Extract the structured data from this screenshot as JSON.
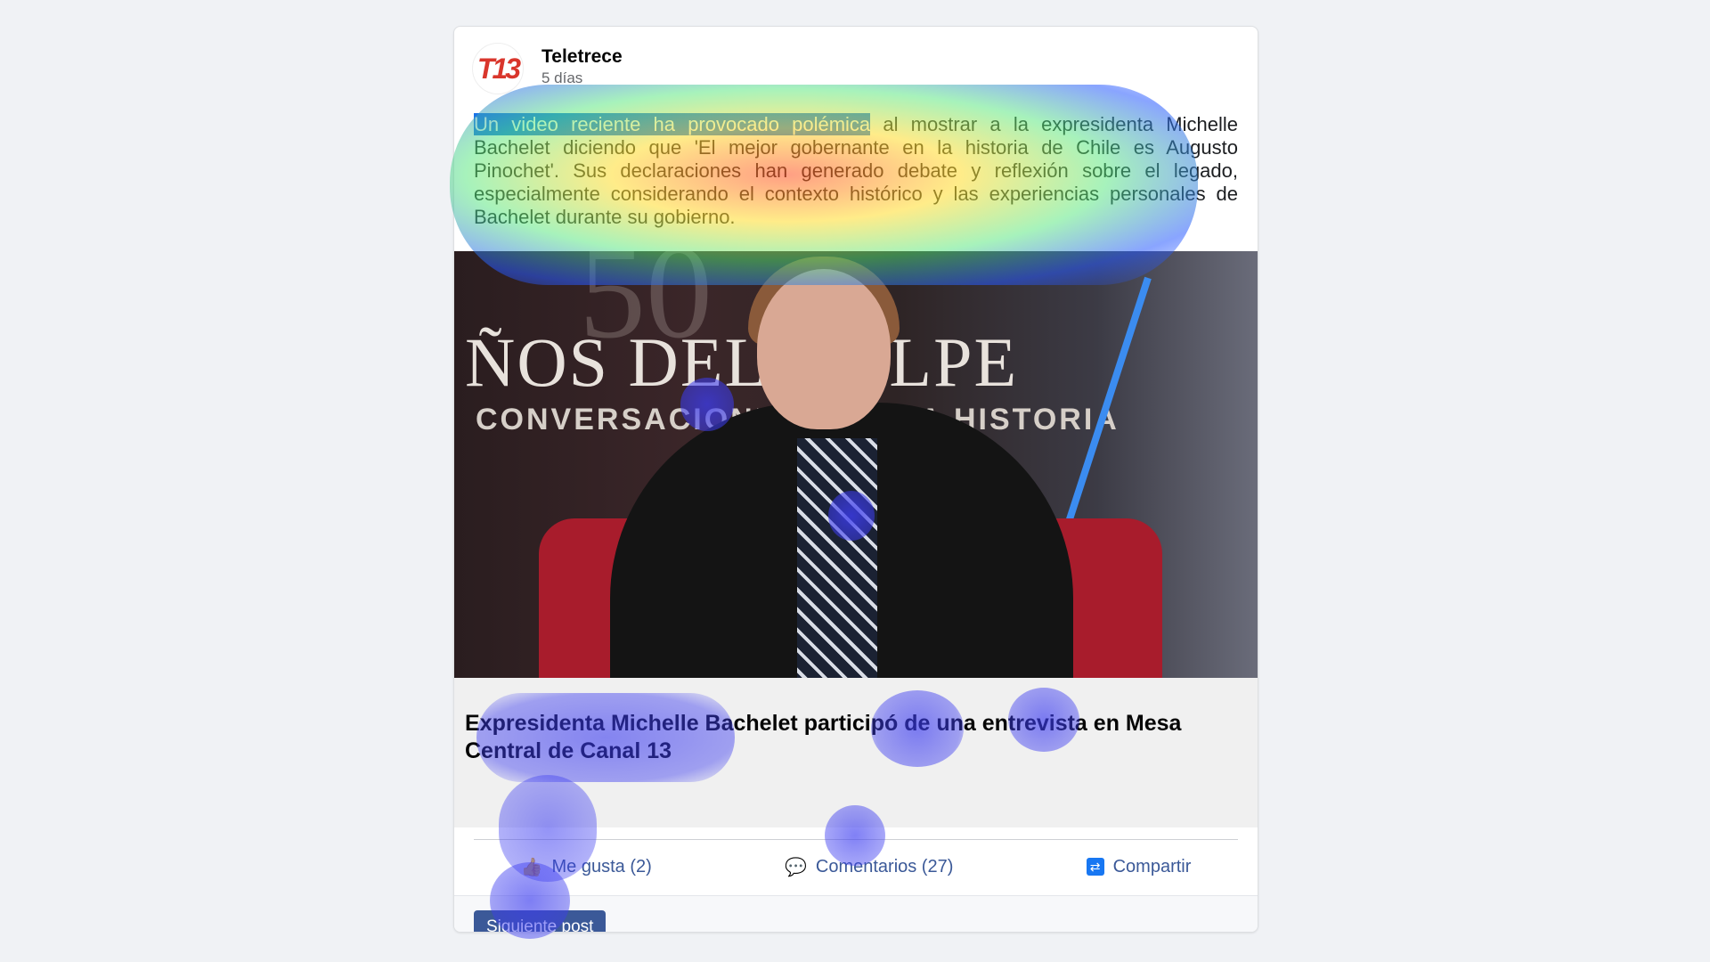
{
  "post": {
    "author": "Teletrece",
    "logo_text": "T13",
    "time": "5 días",
    "text_highlight": "Un video reciente ha provocado polémica",
    "text_rest": " al mostrar a la expresidenta Michelle Bachelet diciendo que 'El mejor gobernante en la historia de Chile es Augusto Pinochet'. Sus declaraciones han generado debate y reflexión sobre el legado, especialmente considerando el contexto histórico y las experiencias personales de Bachelet durante su gobierno.",
    "media": {
      "big_number": "50",
      "title_line": "ÑOS DEL GOLPE",
      "subtitle_line": "CONVERSACIONES CON LA HISTORIA"
    },
    "link_title": "Expresidenta Michelle Bachelet participó de una entrevista en Mesa Central de Canal 13"
  },
  "actions": {
    "like_icon": "👍",
    "like_label": "Me gusta (2)",
    "comment_icon": "💬",
    "comment_label": "Comentarios (27)",
    "share_icon": "⇄",
    "share_label": "Compartir"
  },
  "footer": {
    "next_label": "Siguiente post"
  },
  "colors": {
    "accent": "#3b5998",
    "brand_red": "#d9362c",
    "highlight": "#1a73e8"
  }
}
